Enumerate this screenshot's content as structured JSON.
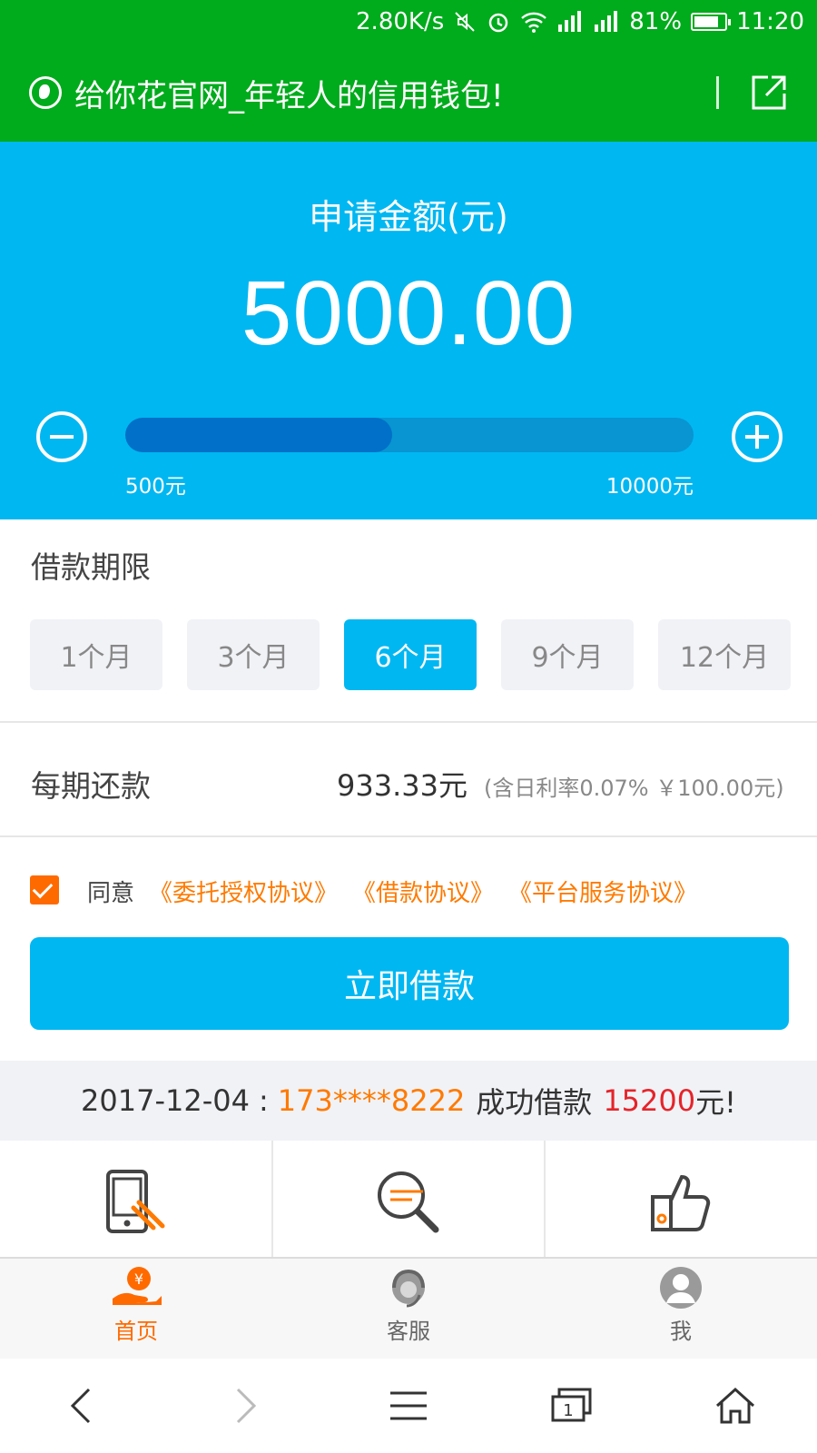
{
  "status_bar": {
    "speed": "2.80K/s",
    "battery": "81%",
    "battery_level": 0.81,
    "time": "11:20"
  },
  "browser": {
    "title": "给你花官网_年轻人的信用钱包!"
  },
  "amount": {
    "label": "申请金额(元)",
    "value": "5000.00",
    "min_label": "500元",
    "max_label": "10000元",
    "slider_level": 0.47
  },
  "term": {
    "label": "借款期限",
    "options": [
      "1个月",
      "3个月",
      "6个月",
      "9个月",
      "12个月"
    ],
    "selected": "6个月"
  },
  "repayment": {
    "label": "每期还款",
    "value": "933.33元",
    "note": "(含日利率0.07% ￥100.00元)"
  },
  "agreement": {
    "checked": true,
    "prefix": "同意",
    "links": [
      "《委托授权协议》",
      "《借款协议》",
      "《平台服务协议》"
    ]
  },
  "submit_label": "立即借款",
  "ticker": {
    "date": "2017-12-04",
    "separator": ":",
    "phone": "173****8222",
    "middle": "成功借款",
    "amount": "15200",
    "suffix": "元!"
  },
  "tabs": [
    {
      "label": "首页",
      "icon": "home-yen-icon",
      "active": true
    },
    {
      "label": "客服",
      "icon": "customer-service-icon",
      "active": false
    },
    {
      "label": "我",
      "icon": "user-icon",
      "active": false
    }
  ],
  "colors": {
    "status_green": "#00ab1c",
    "primary_blue": "#00b7f2",
    "accent_orange": "#ff6a00",
    "ticker_red": "#e5242a"
  }
}
